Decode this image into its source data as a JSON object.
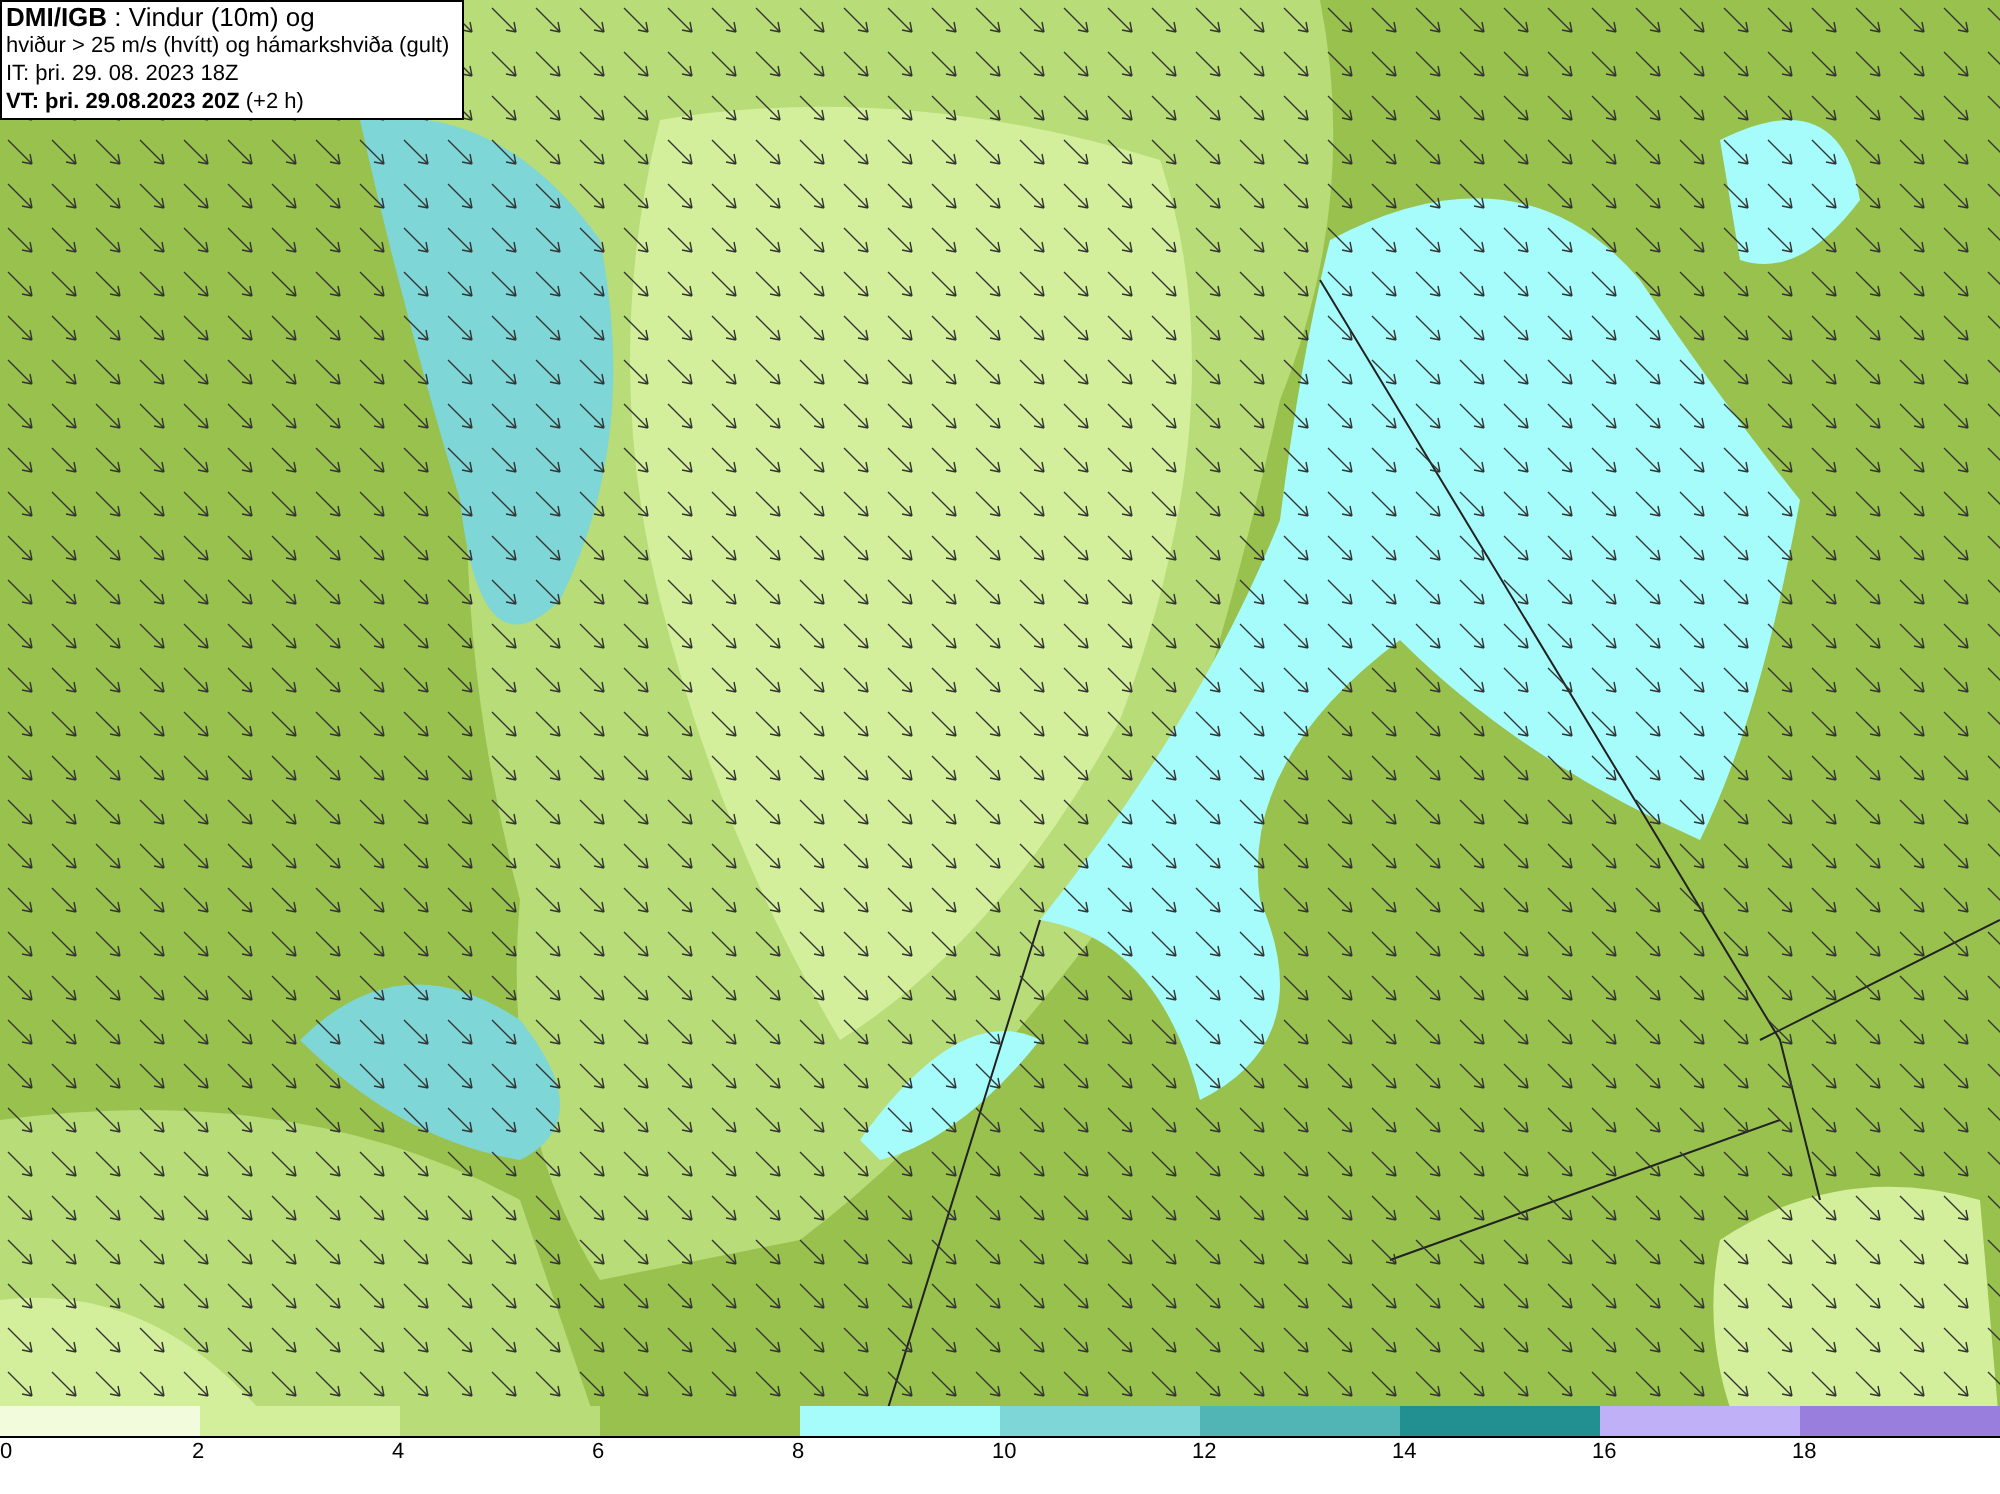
{
  "title_box": {
    "lines": [
      "**DMI/IGB** : Vindur (10m) og",
      "hviður > 25 m/s (hvítt) og hámarkshviða (gult)",
      "IT: þri. 29. 08. 2023 18Z",
      "**VT: þri. 29.08.2023 20Z** (+2 h)"
    ]
  },
  "legend": {
    "bins": [
      {
        "color": "#f2fbdc",
        "label": "0"
      },
      {
        "color": "#d4ef9c",
        "label": "2"
      },
      {
        "color": "#b7dc78",
        "label": "4"
      },
      {
        "color": "#98c14d",
        "label": "6"
      },
      {
        "color": "#a6fbfb",
        "label": "8"
      },
      {
        "color": "#7fd6d6",
        "label": "10"
      },
      {
        "color": "#52b5b5",
        "label": "12"
      },
      {
        "color": "#229090",
        "label": "14"
      },
      {
        "color": "#c0b0f8",
        "label": "16"
      },
      {
        "color": "#9a7ede",
        "label": "18"
      }
    ]
  }
}
